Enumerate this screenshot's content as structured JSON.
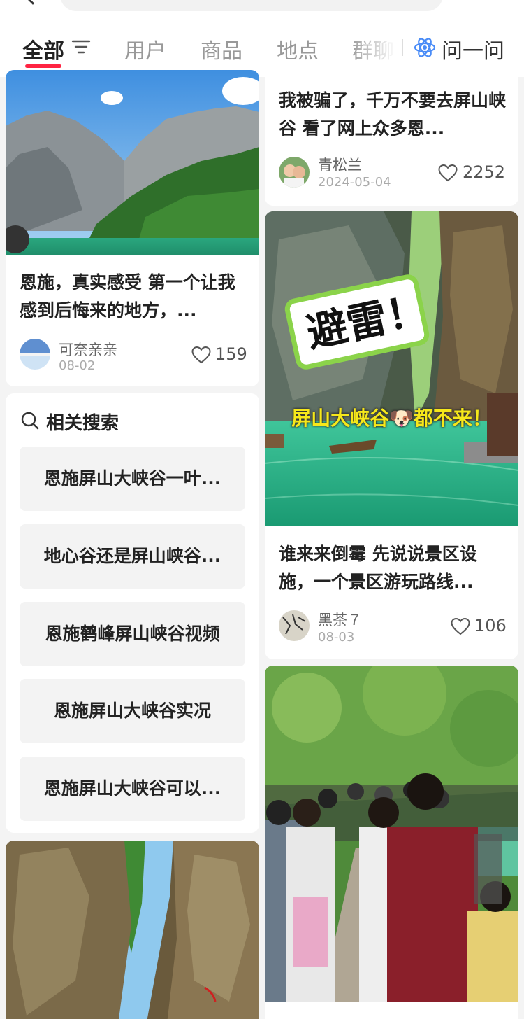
{
  "tabs": {
    "all": "全部",
    "users": "用户",
    "goods": "商品",
    "places": "地点",
    "groups": "群聊",
    "ask": "问一问"
  },
  "notes": {
    "left_1": {
      "title": "恩施，真实感受 第一个让我感到后悔来的地方，...",
      "author": "可奈亲亲",
      "date": "08-02",
      "likes": "159"
    },
    "right_1": {
      "title": "我被骗了，千万不要去屏山峡谷 看了网上众多恩...",
      "author": "青松兰",
      "date": "2024-05-04",
      "likes": "2252"
    },
    "right_2": {
      "title": "谁来来倒霉 先说说景区设施，一个景区游玩路线...",
      "author": "黑茶７",
      "date": "08-03",
      "likes": "106",
      "overlay_big": "避雷！",
      "overlay_caption": "屏山大峡谷🐶都不来！"
    }
  },
  "related": {
    "title": "相关搜索",
    "items": [
      "恩施屏山大峡谷一叶...",
      "地心谷还是屏山峡谷...",
      "恩施鹤峰屏山峡谷视频",
      "恩施屏山大峡谷实况",
      "恩施屏山大峡谷可以..."
    ]
  },
  "colors": {
    "accent": "#ff2442",
    "ask_icon": "#4a8cf7",
    "page_bg": "#f4f4f4",
    "river": "#2fb98a"
  }
}
